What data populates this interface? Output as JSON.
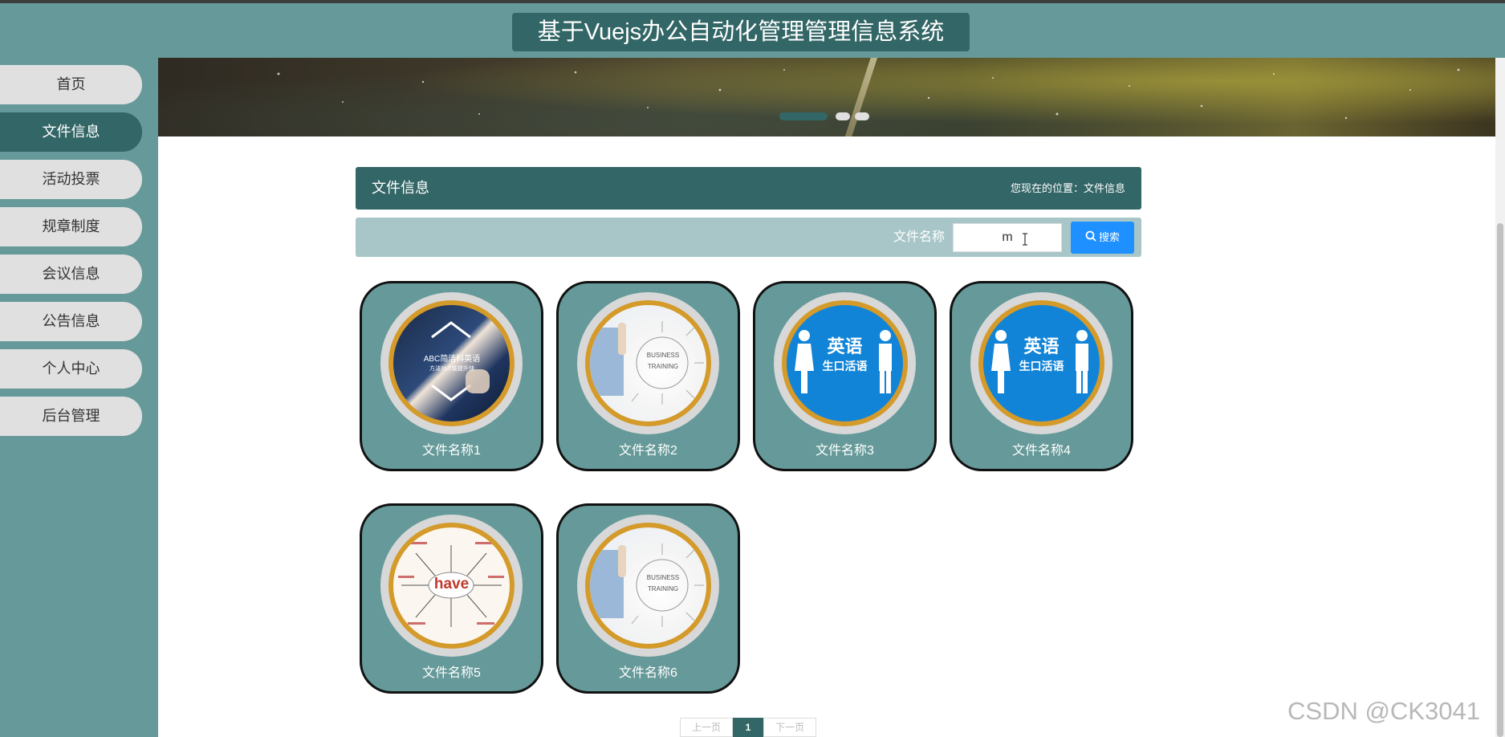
{
  "header": {
    "title": "基于Vuejs办公自动化管理管理信息系统"
  },
  "sidebar": {
    "items": [
      {
        "label": "首页"
      },
      {
        "label": "文件信息"
      },
      {
        "label": "活动投票"
      },
      {
        "label": "规章制度"
      },
      {
        "label": "会议信息"
      },
      {
        "label": "公告信息"
      },
      {
        "label": "个人中心"
      },
      {
        "label": "后台管理"
      }
    ],
    "active_index": 1
  },
  "page": {
    "title": "文件信息",
    "breadcrumb": "您现在的位置：文件信息"
  },
  "search": {
    "label": "文件名称",
    "value": "m",
    "button_label": "搜索",
    "button_color": "#1e90ff"
  },
  "cards": [
    {
      "name": "文件名称1",
      "image": "abc-english-poster",
      "image_text": "ABC简洁科英语",
      "image_subtext": "方法对才能提升快"
    },
    {
      "name": "文件名称2",
      "image": "business-training",
      "image_text": "BUSINESS",
      "image_subtext": "TRAINING"
    },
    {
      "name": "文件名称3",
      "image": "english-speaking",
      "image_text": "英语",
      "image_subtext": "生口活语"
    },
    {
      "name": "文件名称4",
      "image": "english-speaking",
      "image_text": "英语",
      "image_subtext": "生口活语"
    },
    {
      "name": "文件名称5",
      "image": "have-mindmap",
      "image_text": "have",
      "image_subtext": ""
    },
    {
      "name": "文件名称6",
      "image": "business-training",
      "image_text": "BUSINESS",
      "image_subtext": "TRAINING"
    }
  ],
  "pagination": {
    "prev": "上一页",
    "current": "1",
    "next": "下一页"
  },
  "watermark": "CSDN @CK3041",
  "colors": {
    "primary": "#336666",
    "secondary": "#669999",
    "accent_ring": "#d49a2a"
  }
}
